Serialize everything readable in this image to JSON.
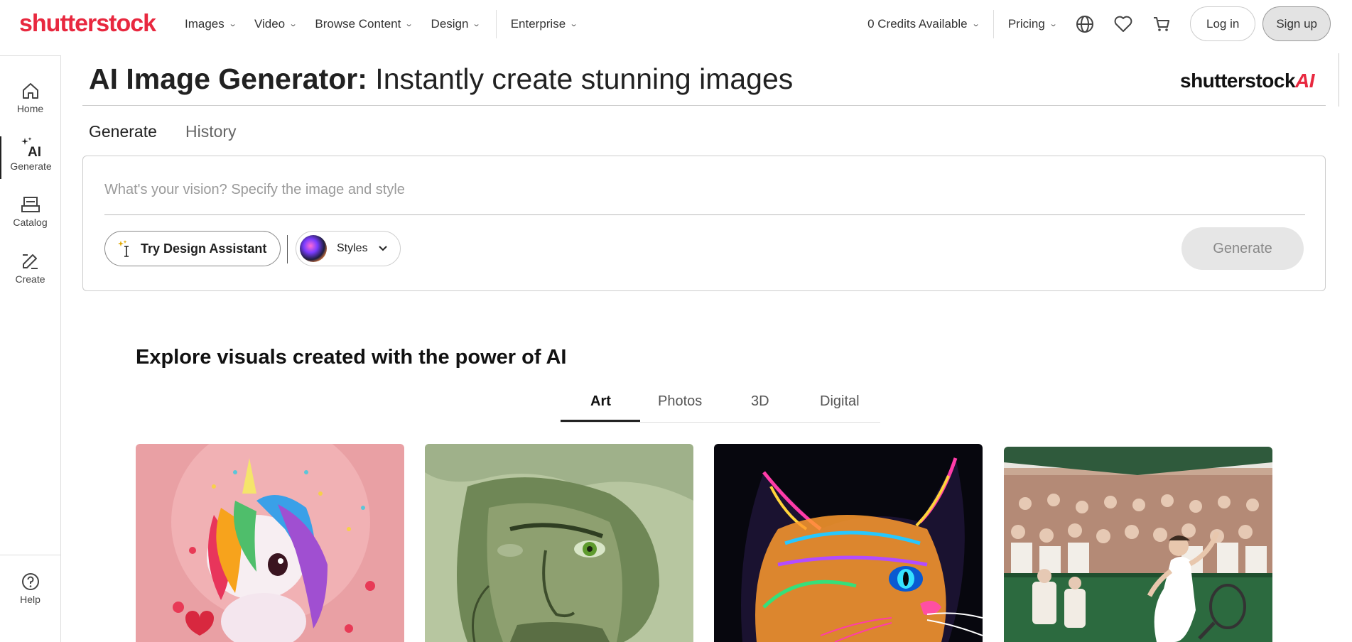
{
  "header": {
    "logo": "shutterstock",
    "nav_left": [
      {
        "label": "Images"
      },
      {
        "label": "Video"
      },
      {
        "label": "Browse Content"
      },
      {
        "label": "Design"
      },
      {
        "label": "Enterprise"
      }
    ],
    "credits": "0 Credits Available",
    "pricing": "Pricing",
    "login": "Log in",
    "signup": "Sign up",
    "icons": [
      "globe-icon",
      "heart-icon",
      "cart-icon"
    ]
  },
  "sidebar": {
    "items": [
      {
        "label": "Home",
        "icon": "home-icon"
      },
      {
        "label": "Generate",
        "icon": "ai-sparkle-icon"
      },
      {
        "label": "Catalog",
        "icon": "catalog-icon"
      },
      {
        "label": "Create",
        "icon": "edit-icon"
      }
    ],
    "help": "Help"
  },
  "page": {
    "title_bold": "AI Image Generator:",
    "title_light": "Instantly create stunning images",
    "brand": "shutterstock",
    "brand_ai": "AI",
    "tabs": [
      "Generate",
      "History"
    ]
  },
  "prompt": {
    "placeholder": "What's your vision? Specify the image and style",
    "assistant_label": "Try Design Assistant",
    "styles_label": "Styles",
    "generate_label": "Generate"
  },
  "explore": {
    "title": "Explore visuals created with the power of AI",
    "categories": [
      "Art",
      "Photos",
      "3D",
      "Digital"
    ],
    "active_category": "Art",
    "cards": [
      {
        "subject": "rainbow unicorn"
      },
      {
        "subject": "green portrait of a man"
      },
      {
        "subject": "neon cat"
      },
      {
        "subject": "tennis player celebrating"
      }
    ]
  },
  "colors": {
    "brand_red": "#e8283f",
    "text": "#212121",
    "muted": "#666666"
  }
}
